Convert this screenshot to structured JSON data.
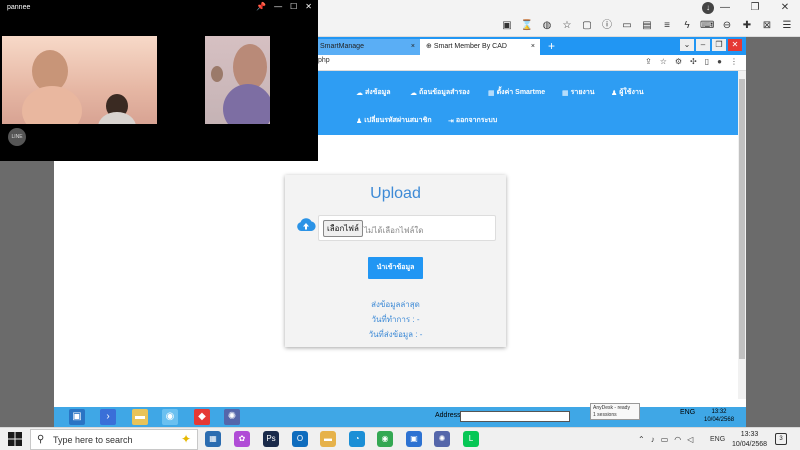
{
  "call_window": {
    "title": "pannee",
    "controls": [
      "pin-icon",
      "minimize-icon",
      "maximize-icon",
      "close-icon"
    ],
    "logo_text": "LINE"
  },
  "inner_browser": {
    "tabs": [
      {
        "label": "SmartManage",
        "close": "×"
      },
      {
        "label": "Smart Member By CAD",
        "close": "×"
      }
    ],
    "new_tab": "+",
    "url_fragment": "php"
  },
  "nav": {
    "items": [
      {
        "label": "ส่งข้อมูล",
        "icon": "cloud-upload-icon"
      },
      {
        "label": "ถ้อนข้อมูลสำรอง",
        "icon": "cloud-download-icon"
      },
      {
        "label": "ตั้งค่า Smartme",
        "icon": "calendar-icon"
      },
      {
        "label": "รายงาน",
        "icon": "grid-icon"
      },
      {
        "label": "ผู้ใช้งาน",
        "icon": "user-icon"
      },
      {
        "label": "เปลี่ยนรหัสผ่านสมาชิก",
        "icon": "user-icon"
      },
      {
        "label": "ออกจากระบบ",
        "icon": "logout-icon"
      }
    ]
  },
  "upload": {
    "title": "Upload",
    "choose_file_label": "เลือกไฟล์",
    "file_status": "ไม่ได้เลือกไฟล์ใด",
    "import_button": "นำเข้าข้อมูล",
    "last_sent_label": "ส่งข้อมูลล่าสุด",
    "process_date_label": "วันที่ทำการ : -",
    "send_date_label": "วันที่ส่งข้อมูล : -"
  },
  "remote_taskbar": {
    "address_label": "Address",
    "anydesk_tip_line1": "AnyDesk - ready",
    "anydesk_tip_line2": "1 sessions",
    "lang": "ENG",
    "time": "13:32",
    "date": "10/04/2568"
  },
  "windows_taskbar": {
    "search_placeholder": "Type here to search",
    "lang": "ENG",
    "time": "13:33",
    "date": "10/04/2568",
    "notification_count": "3"
  },
  "colors": {
    "accent_blue": "#2196f3",
    "nav_blue": "#2e9df3",
    "title_blue": "#3d8ad6"
  }
}
